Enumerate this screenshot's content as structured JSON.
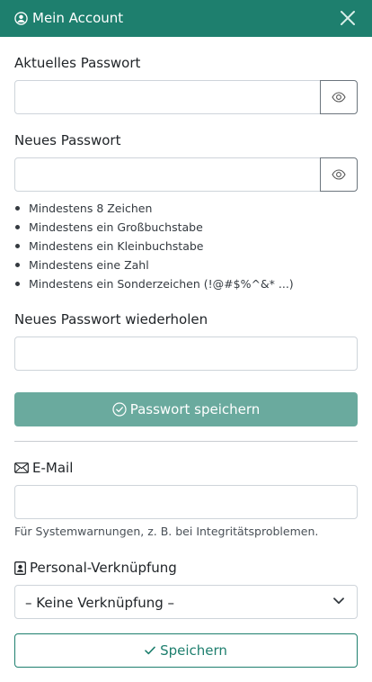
{
  "header": {
    "title": "Mein Account",
    "bg_color": "#1e7f6e",
    "icons": {
      "account": "user-circle-icon",
      "close": "close-icon"
    }
  },
  "password": {
    "current_label": "Aktuelles Passwort",
    "current_value": "",
    "new_label": "Neues Passwort",
    "new_value": "",
    "rules": [
      "Mindestens 8 Zeichen",
      "Mindestens ein Großbuchstabe",
      "Mindestens ein Kleinbuchstabe",
      "Mindestens eine Zahl",
      "Mindestens ein Sonderzeichen (!@#$%^&* ...)"
    ],
    "repeat_label": "Neues Passwort wiederholen",
    "repeat_value": "",
    "save_label": "Passwort speichern",
    "save_color": "#6aaa9e",
    "eye_icon": "eye-icon"
  },
  "email": {
    "label": "E-Mail",
    "icon": "envelope-icon",
    "value": "",
    "hint": "Für Systemwarnungen, z. B. bei Integritätsproblemen."
  },
  "personal": {
    "label": "Personal-Verknüpfung",
    "icon": "person-badge-icon",
    "selected": "– Keine Verknüpfung –"
  },
  "footer": {
    "save_label": "Speichern",
    "accent": "#1e7f6e"
  }
}
